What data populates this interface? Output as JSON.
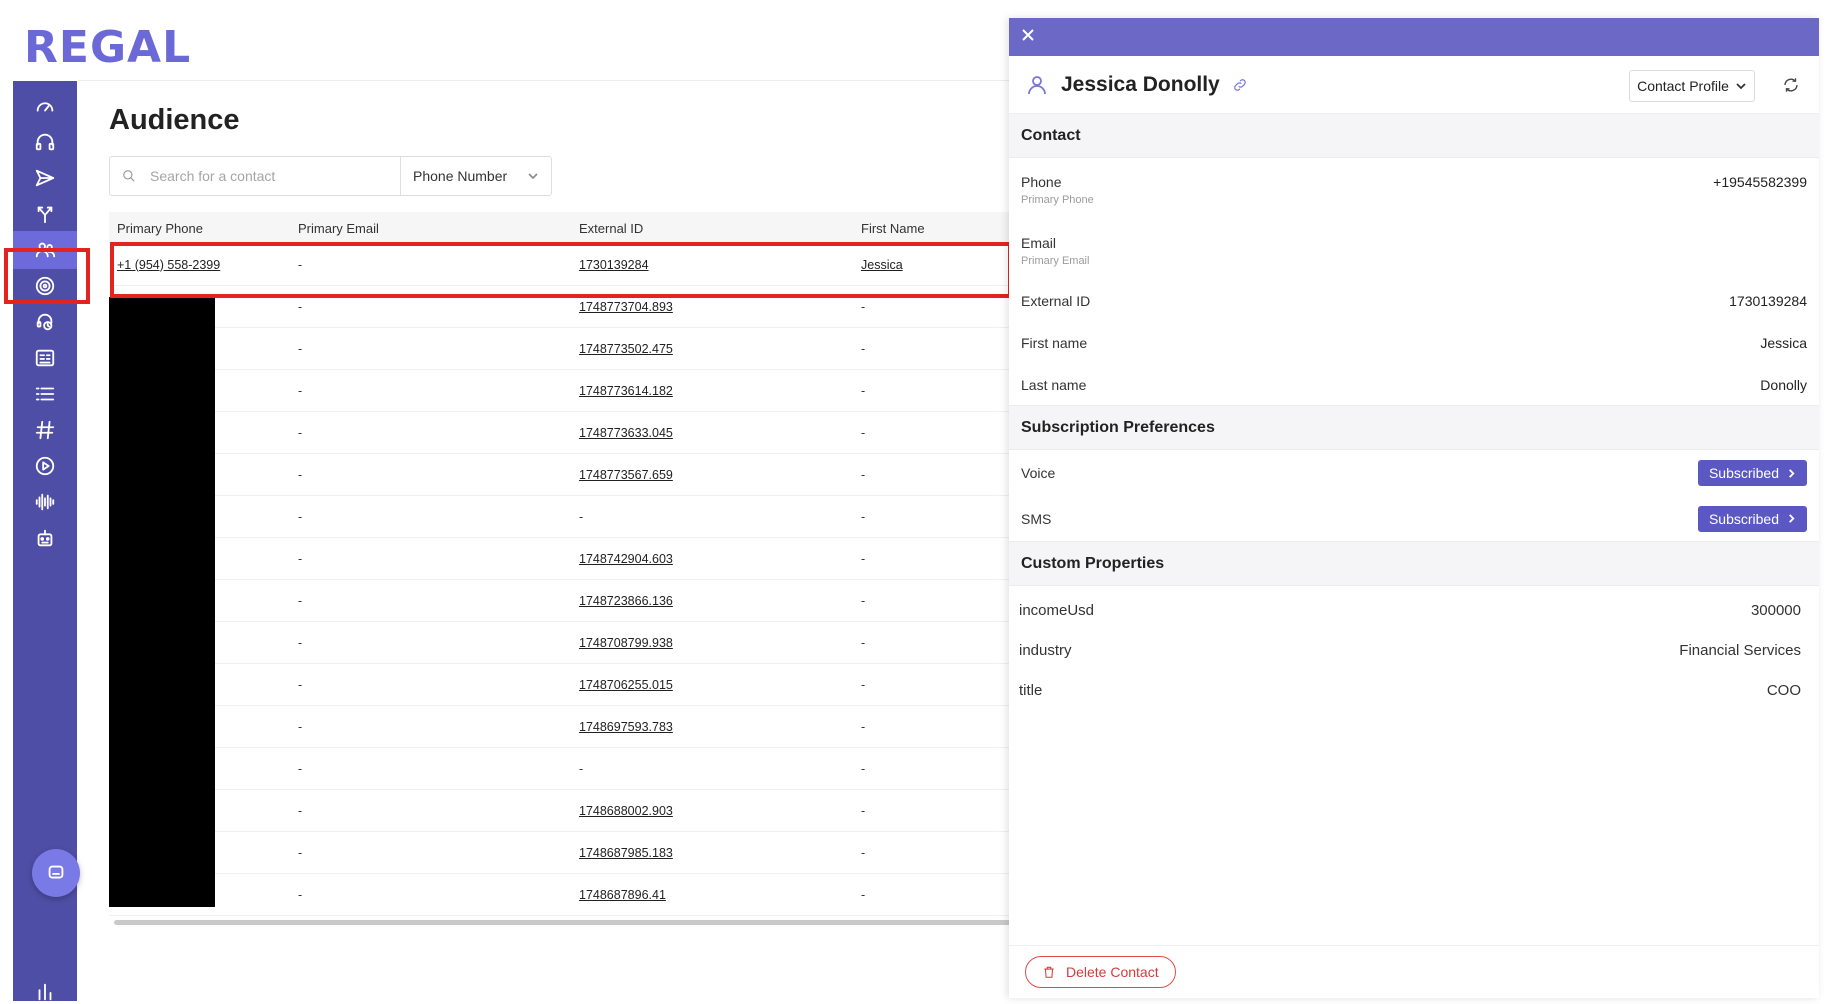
{
  "app": {
    "logo": "REGAL"
  },
  "sidebar": {
    "items": [
      {
        "icon": "dashboard-gauge-icon"
      },
      {
        "icon": "headset-icon"
      },
      {
        "icon": "send-icon"
      },
      {
        "icon": "journey-branch-icon"
      },
      {
        "icon": "audience-users-icon",
        "active": true
      },
      {
        "icon": "target-icon"
      },
      {
        "icon": "agent-headset-icon"
      },
      {
        "icon": "contact-card-icon"
      },
      {
        "icon": "list-icon"
      },
      {
        "icon": "hashtag-icon"
      },
      {
        "icon": "play-icon"
      },
      {
        "icon": "audio-wave-icon"
      },
      {
        "icon": "bot-icon"
      },
      {
        "icon": "bar-chart-icon"
      },
      {
        "icon": "settings-gear-icon"
      }
    ]
  },
  "main": {
    "title": "Audience",
    "search": {
      "placeholder": "Search for a contact",
      "type_label": "Phone Number"
    },
    "table": {
      "headers": [
        "Primary Phone",
        "Primary Email",
        "External ID",
        "First Name"
      ],
      "rows": [
        {
          "phone": "+1 (954) 558-2399",
          "email": "-",
          "external_id": "1730139284",
          "first_name": "Jessica"
        },
        {
          "phone": "",
          "email": "-",
          "external_id": "1748773704.893",
          "first_name": "-"
        },
        {
          "phone": "",
          "email": "-",
          "external_id": "1748773502.475",
          "first_name": "-"
        },
        {
          "phone": "",
          "email": "-",
          "external_id": "1748773614.182",
          "first_name": "-"
        },
        {
          "phone": "",
          "email": "-",
          "external_id": "1748773633.045",
          "first_name": "-"
        },
        {
          "phone": "",
          "email": "-",
          "external_id": "1748773567.659",
          "first_name": "-"
        },
        {
          "phone": "",
          "email": "-",
          "external_id": "-",
          "first_name": "-"
        },
        {
          "phone": "",
          "email": "-",
          "external_id": "1748742904.603",
          "first_name": "-"
        },
        {
          "phone": "",
          "email": "-",
          "external_id": "1748723866.136",
          "first_name": "-"
        },
        {
          "phone": "",
          "email": "-",
          "external_id": "1748708799.938",
          "first_name": "-"
        },
        {
          "phone": "",
          "email": "-",
          "external_id": "1748706255.015",
          "first_name": "-"
        },
        {
          "phone": "",
          "email": "-",
          "external_id": "1748697593.783",
          "first_name": "-"
        },
        {
          "phone": "",
          "email": "-",
          "external_id": "-",
          "first_name": "-"
        },
        {
          "phone": "",
          "email": "-",
          "external_id": "1748688002.903",
          "first_name": "-"
        },
        {
          "phone": "",
          "email": "-",
          "external_id": "1748687985.183",
          "first_name": "-"
        },
        {
          "phone": "",
          "email": "-",
          "external_id": "1748687896.41",
          "first_name": "-"
        }
      ]
    }
  },
  "panel": {
    "name": "Jessica Donolly",
    "profile_dropdown": "Contact Profile",
    "contact_section": "Contact",
    "phone": {
      "label": "Phone",
      "sub": "Primary Phone",
      "value": "+19545582399"
    },
    "email": {
      "label": "Email",
      "sub": "Primary Email",
      "value": ""
    },
    "external_id": {
      "label": "External ID",
      "value": "1730139284"
    },
    "first_name": {
      "label": "First name",
      "value": "Jessica"
    },
    "last_name": {
      "label": "Last name",
      "value": "Donolly"
    },
    "subscription_section": "Subscription Preferences",
    "voice": {
      "label": "Voice",
      "status": "Subscribed"
    },
    "sms": {
      "label": "SMS",
      "status": "Subscribed"
    },
    "custom_section": "Custom Properties",
    "custom": [
      {
        "key": "incomeUsd",
        "value": "300000"
      },
      {
        "key": "industry",
        "value": "Financial Services"
      },
      {
        "key": "title",
        "value": "COO"
      }
    ],
    "delete_label": "Delete Contact"
  },
  "colors": {
    "brand": "#6b68d8",
    "sidebar": "#4e4ea6",
    "panel_bar": "#6b68c6",
    "badge": "#5b58c4",
    "highlight": "#e3231f",
    "danger": "#d43c3c"
  }
}
